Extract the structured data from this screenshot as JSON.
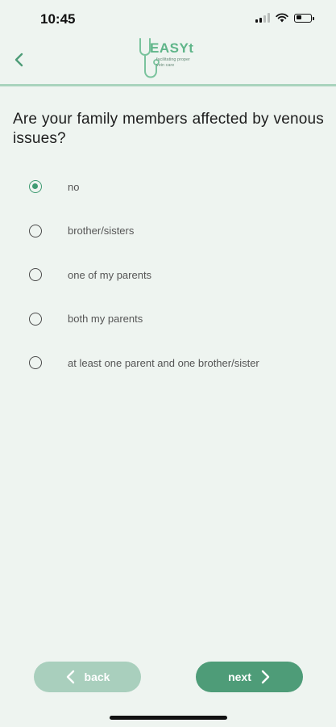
{
  "status_bar": {
    "time": "10:45",
    "icons": [
      "cellular-signal-icon",
      "wifi-icon",
      "battery-icon"
    ],
    "battery_level": 0.35
  },
  "header": {
    "back_icon": "chevron-left-icon",
    "logo": {
      "text": "EASYt",
      "tagline": "facilitating proper vein care"
    }
  },
  "question": {
    "text": "Are your family members affected by venous issues?"
  },
  "options": [
    {
      "label": "no",
      "selected": true
    },
    {
      "label": "brother/sisters",
      "selected": false
    },
    {
      "label": "one of my parents",
      "selected": false
    },
    {
      "label": "both my parents",
      "selected": false
    },
    {
      "label": "at least one parent and one brother/sister",
      "selected": false
    }
  ],
  "buttons": {
    "back_label": "back",
    "next_label": "next"
  },
  "colors": {
    "background": "#eef4f0",
    "accent": "#4e9c78",
    "accent_light": "#a9cfbd",
    "header_rule": "#a9d3bd"
  }
}
